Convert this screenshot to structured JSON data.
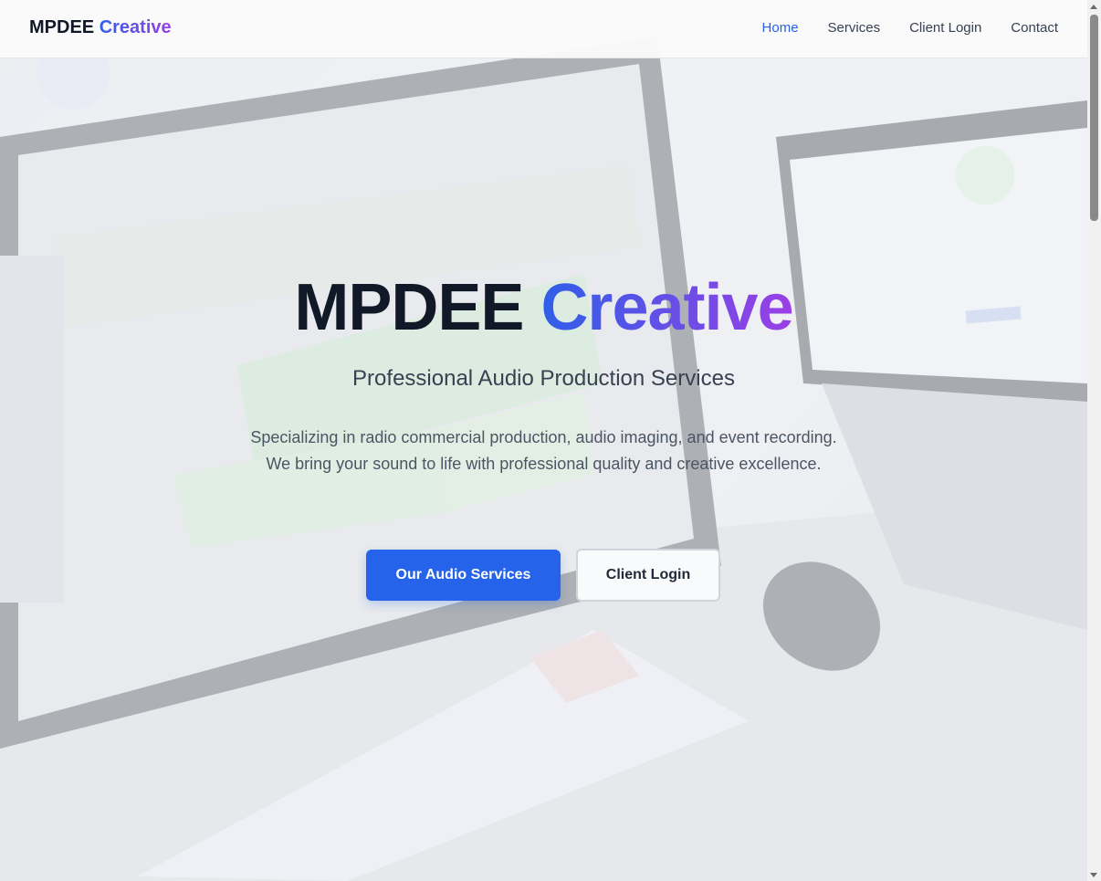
{
  "navbar": {
    "brand_part1": "MPDEE",
    "brand_part2": "Creative",
    "links": [
      {
        "label": "Home",
        "active": true
      },
      {
        "label": "Services",
        "active": false
      },
      {
        "label": "Client Login",
        "active": false
      },
      {
        "label": "Contact",
        "active": false
      }
    ]
  },
  "hero": {
    "title_part1": "MPDEE",
    "title_part2": "Creative",
    "subtitle": "Professional Audio Production Services",
    "description": "Specializing in radio commercial production, audio imaging, and event recording. We bring your sound to life with professional quality and creative excellence.",
    "primary_button": "Our Audio Services",
    "secondary_button": "Client Login",
    "background_icon": "audio-studio-photo"
  },
  "colors": {
    "accent": "#2563eb",
    "gradient_start": "#2f5fe8",
    "gradient_end": "#9b3fe6",
    "text_dark": "#111827"
  }
}
